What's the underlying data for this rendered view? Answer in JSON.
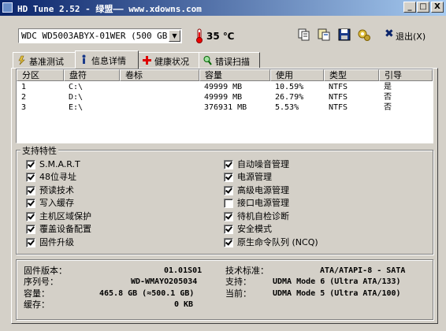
{
  "window": {
    "title": "HD Tune 2.52 - 绿盟—— www.xdowns.com",
    "min_label": "_",
    "max_label": "□",
    "close_label": "X"
  },
  "toolbar": {
    "drive_select": "WDC WD5003ABYX-01WER (500 GB)",
    "temperature": "35 ℃",
    "exit_label": "退出(X)",
    "buttons": [
      "copy-icon",
      "copy-screen-icon",
      "save-icon",
      "options-icon"
    ]
  },
  "tabs": [
    {
      "label": "基准测试",
      "icon": "benchmark-icon"
    },
    {
      "label": "信息详情",
      "icon": "info-icon"
    },
    {
      "label": "健康状况",
      "icon": "health-icon"
    },
    {
      "label": "错误扫描",
      "icon": "scan-icon"
    }
  ],
  "partitions": {
    "columns": [
      "分区",
      "盘符",
      "卷标",
      "容量",
      "使用",
      "类型",
      "引导"
    ],
    "rows": [
      [
        "1",
        "C:\\",
        "",
        "49999 MB",
        "10.59%",
        "NTFS",
        "是"
      ],
      [
        "2",
        "D:\\",
        "",
        "49999 MB",
        "26.79%",
        "NTFS",
        "否"
      ],
      [
        "3",
        "E:\\",
        "",
        "376931 MB",
        "5.53%",
        "NTFS",
        "否"
      ]
    ]
  },
  "features": {
    "title": "支持特性",
    "left": [
      {
        "label": "S.M.A.R.T",
        "checked": true
      },
      {
        "label": "48位寻址",
        "checked": true
      },
      {
        "label": "预读技术",
        "checked": true
      },
      {
        "label": "写入缓存",
        "checked": true
      },
      {
        "label": "主机区域保护",
        "checked": true
      },
      {
        "label": "覆盖设备配置",
        "checked": true
      },
      {
        "label": "固件升级",
        "checked": true
      }
    ],
    "right": [
      {
        "label": "自动噪音管理",
        "checked": true
      },
      {
        "label": "电源管理",
        "checked": true
      },
      {
        "label": "高级电源管理",
        "checked": true
      },
      {
        "label": "接口电源管理",
        "checked": false
      },
      {
        "label": "待机自检诊断",
        "checked": true
      },
      {
        "label": "安全模式",
        "checked": true
      },
      {
        "label": "原生命令队列 (NCQ)",
        "checked": true
      }
    ]
  },
  "info": {
    "firmware_label": "固件版本：",
    "firmware_value": "01.01S01",
    "serial_label": "序列号：",
    "serial_value": "WD-WMAYO205034",
    "capacity_label": "容量：",
    "capacity_value": "465.8 GB (≈500.1 GB)",
    "cache_label": "缓存：",
    "cache_value": "0 KB",
    "standard_label": "技术标准：",
    "standard_value": "ATA/ATAPI-8 - SATA",
    "supported_label": "支持：",
    "supported_value": "UDMA Mode 6 (Ultra ATA/133)",
    "current_label": "当前：",
    "current_value": "UDMA Mode 5 (Ultra ATA/100)"
  }
}
